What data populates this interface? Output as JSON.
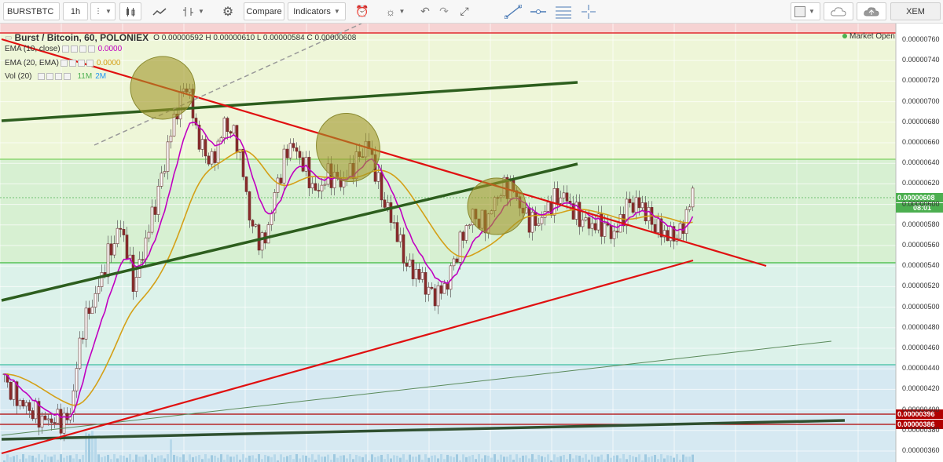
{
  "toolbar": {
    "symbol": "BURSTBTC",
    "interval": "1h",
    "compare_label": "Compare",
    "indicators_label": "Indicators",
    "right_symbol": "XEM"
  },
  "legend": {
    "title": "Burst / Bitcoin, 60, POLONIEX",
    "ohlc": "O 0.00000592 H 0.00000610 L 0.00000584 C 0.00000608",
    "ema10_label": "EMA (10, close)",
    "ema10_value": "0.0000",
    "ema20_label": "EMA (20, EMA)",
    "ema20_value": "0.0000",
    "vol_label": "Vol (20)",
    "vol_value1": "11M",
    "vol_value2": "2M"
  },
  "market_status": "Market Open",
  "price_tags": {
    "last": "0.00000608",
    "countdown": "08:01",
    "line1": "0.00000396",
    "line2": "0.00000386"
  },
  "colors": {
    "ema10": "#c000c0",
    "ema20": "#d4a017",
    "up": "#4caf50",
    "down": "#8b2a2a",
    "trend_red": "#e01010",
    "trend_green": "#2d5e1e"
  },
  "chart_data": {
    "type": "candlestick",
    "price_axis_ticks": [
      "0.00000760",
      "0.00000740",
      "0.00000720",
      "0.00000700",
      "0.00000680",
      "0.00000660",
      "0.00000640",
      "0.00000620",
      "0.00000600",
      "0.00000580",
      "0.00000560",
      "0.00000540",
      "0.00000520",
      "0.00000500",
      "0.00000480",
      "0.00000460",
      "0.00000440",
      "0.00000420",
      "0.00000400",
      "0.00000380",
      "0.00000360"
    ],
    "ylim": [
      3.55e-06,
      7.75e-06
    ],
    "close_path": [
      4.3e-06,
      4.1e-06,
      4e-06,
      3.9e-06,
      3.9e-06,
      3.9e-06,
      4.8e-06,
      5.1e-06,
      5.5e-06,
      5.8e-06,
      5.2e-06,
      5.7e-06,
      6.2e-06,
      6.8e-06,
      7.2e-06,
      6.6e-06,
      6.4e-06,
      6.8e-06,
      6.6e-06,
      5.8e-06,
      5.6e-06,
      6.2e-06,
      6.6e-06,
      6.4e-06,
      6.1e-06,
      6.3e-06,
      6.2e-06,
      6.4e-06,
      6.6e-06,
      6.1e-06,
      5.8e-06,
      5.4e-06,
      5.3e-06,
      5.1e-06,
      5.2e-06,
      5.6e-06,
      5.9e-06,
      5.8e-06,
      6.1e-06,
      6.2e-06,
      5.9e-06,
      5.8e-06,
      6e-06,
      6.1e-06,
      5.9e-06,
      5.8e-06,
      5.8e-06,
      5.7e-06,
      6e-06,
      6e-06,
      5.8e-06,
      5.7e-06,
      5.7e-06,
      6.1e-06
    ]
  }
}
